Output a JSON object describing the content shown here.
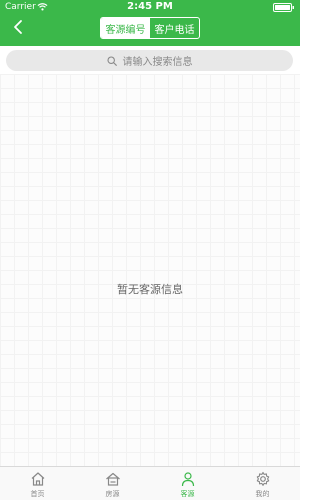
{
  "status_bar": {
    "carrier": "Carrier",
    "time": "2:45 PM"
  },
  "nav": {
    "back_icon": "chevron-left-icon",
    "tabs": [
      {
        "label": "客源编号",
        "active": true
      },
      {
        "label": "客户电话",
        "active": false
      }
    ]
  },
  "search": {
    "icon": "search-icon",
    "placeholder": "请输入搜索信息"
  },
  "content": {
    "empty_message": "暂无客源信息"
  },
  "tabbar": {
    "items": [
      {
        "label": "首页",
        "icon": "home-icon",
        "active": false
      },
      {
        "label": "房源",
        "icon": "house-icon",
        "active": false
      },
      {
        "label": "客源",
        "icon": "person-icon",
        "active": true
      },
      {
        "label": "我的",
        "icon": "gear-icon",
        "active": false
      }
    ]
  },
  "colors": {
    "accent": "#3bb84a",
    "inactive": "#888888",
    "empty_text": "#666666"
  }
}
